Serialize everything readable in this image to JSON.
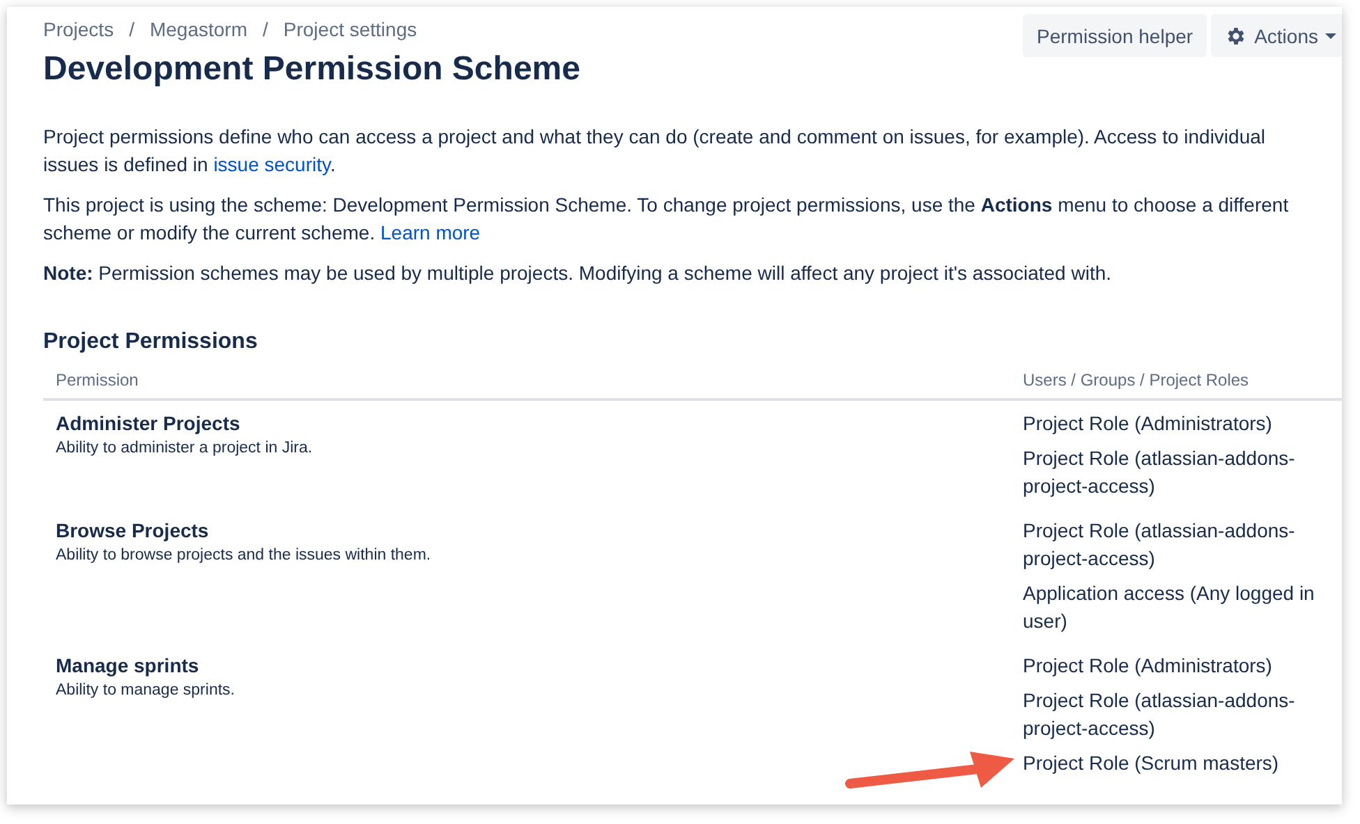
{
  "breadcrumbs": [
    "Projects",
    "Megastorm",
    "Project settings"
  ],
  "breadcrumb_separator": "/",
  "header_buttons": [
    {
      "label": "Permission helper",
      "kind": "plain"
    },
    {
      "label": "Actions",
      "kind": "menu"
    }
  ],
  "title": "Development Permission Scheme",
  "paragraphs": [
    [
      {
        "kind": "text",
        "text": "Project permissions define who can access a project and what they can do (create and comment on issues, for example). Access to individual issues is defined in "
      },
      {
        "kind": "link",
        "text": "issue security"
      },
      {
        "kind": "text",
        "text": "."
      }
    ],
    [
      {
        "kind": "text",
        "text": "This project is using the scheme: Development Permission Scheme. To change project permissions, use the **Actions** menu to choose a different scheme or modify the current scheme. "
      },
      {
        "kind": "link",
        "text": "Learn more"
      }
    ],
    [
      {
        "kind": "text",
        "text": "**Note:** Permission schemes may be used by multiple projects. Modifying a scheme will affect any project it's associated with."
      }
    ]
  ],
  "section_title": "Project Permissions",
  "table": {
    "columns": [
      "Permission",
      "Users / Groups / Project Roles"
    ],
    "rows": [
      {
        "name": "Administer Projects",
        "description": "Ability to administer a project in Jira.",
        "grants": [
          "Project Role (Administrators)",
          "Project Role (atlassian-addons-project-access)"
        ]
      },
      {
        "name": "Browse Projects",
        "description": "Ability to browse projects and the issues within them.",
        "grants": [
          "Project Role (atlassian-addons-project-access)",
          "Application access (Any logged in user)"
        ]
      },
      {
        "name": "Manage sprints",
        "description": "Ability to manage sprints.",
        "grants": [
          "Project Role (Administrators)",
          "Project Role (atlassian-addons-project-access)",
          "Project Role (Scrum masters)"
        ]
      }
    ]
  },
  "annotation": {
    "kind": "arrow"
  }
}
